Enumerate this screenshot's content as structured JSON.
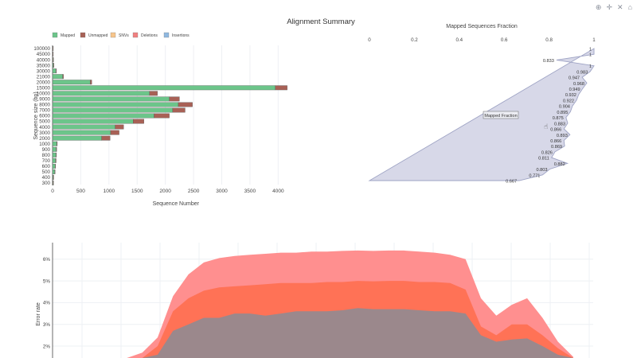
{
  "title": "Alignment Summary",
  "modebar": {
    "icons": [
      "zoom-icon",
      "pan-icon",
      "autoscale-icon",
      "home-icon"
    ],
    "glyphs": [
      "⊕",
      "✛",
      "✕",
      "⌂"
    ]
  },
  "colors": {
    "mapped": "#6cc58a",
    "unmapped": "#a86156",
    "snvs": "#f7c58b",
    "deletions": "#f08080",
    "insertions": "#8fb8e0",
    "fraction_fill": "#d7d8e8",
    "fraction_line": "#9ea3c4",
    "err_outer": "#ff8f8f",
    "err_mid": "#ff7256",
    "err_inner": "#9b888c"
  },
  "chart_data": [
    {
      "type": "bar",
      "orientation": "horizontal",
      "barmode": "stack",
      "xlabel": "Sequence Number",
      "ylabel": "Sequence size (bp)",
      "xlim": [
        0,
        4200
      ],
      "xticks": [
        "0",
        "500",
        "1000",
        "1500",
        "2000",
        "2500",
        "3000",
        "3500",
        "4000"
      ],
      "legend": [
        "Mapped",
        "Unmapped",
        "SNVs",
        "Deletions",
        "Insertions"
      ],
      "legend_position": "top-left",
      "categories": [
        "300",
        "400",
        "500",
        "600",
        "700",
        "800",
        "900",
        "1000",
        "2000",
        "3000",
        "4000",
        "5000",
        "6000",
        "7000",
        "8000",
        "9000",
        "10000",
        "15000",
        "20000",
        "21000",
        "30000",
        "35000",
        "40000",
        "45000",
        "100000"
      ],
      "series": [
        {
          "name": "Mapped",
          "values": [
            8,
            12,
            38,
            45,
            55,
            60,
            65,
            75,
            870,
            1030,
            1110,
            1430,
            1800,
            2130,
            2230,
            2070,
            1720,
            3950,
            670,
            180,
            60,
            15,
            8,
            4,
            4
          ]
        },
        {
          "name": "Unmapped",
          "values": [
            1,
            2,
            4,
            5,
            6,
            6,
            6,
            6,
            150,
            150,
            150,
            190,
            270,
            220,
            250,
            180,
            140,
            210,
            25,
            15,
            5,
            2,
            1,
            1,
            1
          ]
        }
      ]
    },
    {
      "type": "area",
      "title": "Mapped Sequences Fraction",
      "xlim": [
        0,
        1
      ],
      "xticks": [
        "0",
        "0.2",
        "0.4",
        "0.6",
        "0.8",
        "1"
      ],
      "grid": false,
      "hover_label": "Mapped Fraction",
      "x": [
        0.667,
        0.771,
        0.803,
        0.882,
        0.811,
        0.826,
        0.869,
        0.866,
        0.893,
        0.866,
        0.883,
        0.875,
        0.895,
        0.904,
        0.922,
        0.932,
        0.949,
        0.968,
        0.947,
        0.983,
        1,
        0.833,
        1,
        1
      ],
      "point_labels": [
        "0.667",
        "0.771",
        "0.803",
        "0.882",
        "0.811",
        "0.826",
        "0.869",
        "0.866",
        "0.893",
        "0.866",
        "0.883",
        "0.875",
        "0.895",
        "0.904",
        "0.922",
        "0.932",
        "0.949",
        "0.968",
        "0.947",
        "0.983",
        "1",
        "0.833",
        "1",
        "1"
      ]
    },
    {
      "type": "area",
      "ylabel": "Error rate",
      "yticks": [
        "2%",
        "3%",
        "4%",
        "5%",
        "6%"
      ],
      "series": [
        {
          "name": "",
          "values": [
            1.05,
            1.3,
            1.7,
            2.4,
            4.3,
            5.3,
            5.85,
            6.05,
            6.15,
            6.2,
            6.25,
            6.3,
            6.3,
            6.35,
            6.35,
            6.38,
            6.4,
            6.38,
            6.4,
            6.4,
            6.35,
            6.3,
            6.2,
            6.0,
            4.2,
            3.4,
            3.9,
            4.2,
            3.3,
            2.2,
            1.5
          ]
        },
        {
          "name": "",
          "values": [
            0.9,
            1.1,
            1.4,
            2.0,
            3.6,
            4.2,
            4.55,
            4.7,
            4.75,
            4.8,
            4.85,
            4.9,
            4.9,
            4.9,
            4.95,
            4.95,
            5.0,
            4.98,
            5.0,
            5.0,
            4.95,
            4.95,
            4.9,
            4.6,
            2.9,
            2.5,
            3.0,
            3.0,
            2.5,
            1.9,
            1.4
          ]
        },
        {
          "name": "",
          "values": [
            0.7,
            0.9,
            1.2,
            1.6,
            2.7,
            3.0,
            3.3,
            3.3,
            3.5,
            3.5,
            3.4,
            3.5,
            3.6,
            3.6,
            3.6,
            3.65,
            3.75,
            3.7,
            3.7,
            3.7,
            3.65,
            3.6,
            3.6,
            3.5,
            2.5,
            2.2,
            2.3,
            2.35,
            2.0,
            1.6,
            1.2
          ]
        }
      ]
    }
  ]
}
